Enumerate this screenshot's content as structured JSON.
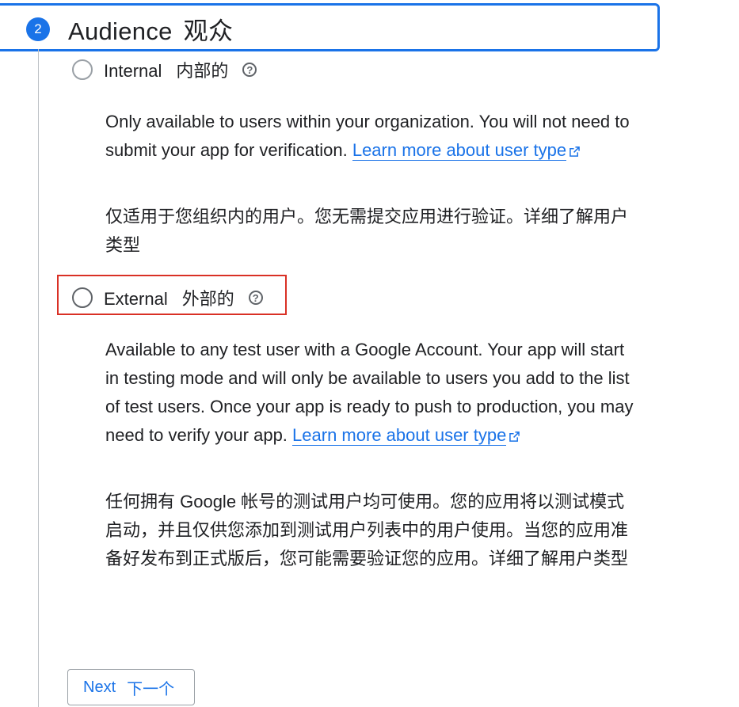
{
  "step": {
    "number": "2",
    "title": "Audience",
    "title_zh": "观众"
  },
  "internal": {
    "label": "Internal",
    "label_zh": "内部的",
    "help_icon": "help-circle-icon",
    "description": "Only available to users within your organization. You will not need to submit your app for verification.",
    "link_text": "Learn more about user type",
    "description_zh": "仅适用于您组织内的用户。您无需提交应用进行验证。详细了解用户类型"
  },
  "external": {
    "label": "External",
    "label_zh": "外部的",
    "help_icon": "help-circle-icon",
    "description": "Available to any test user with a Google Account. Your app will start in testing mode and will only be available to users you add to the list of test users. Once your app is ready to push to production, you may need to verify your app.",
    "link_text": "Learn more about user type",
    "description_zh": "任何拥有 Google 帐号的测试用户均可使用。您的应用将以测试模式启动，并且仅供您添加到测试用户列表中的用户使用。当您的应用准备好发布到正式版后，您可能需要验证您的应用。详细了解用户类型"
  },
  "next_button": {
    "label": "Next",
    "label_zh": "下一个"
  },
  "colors": {
    "accent": "#1a73e8",
    "highlight": "#d93025",
    "text": "#202124"
  }
}
